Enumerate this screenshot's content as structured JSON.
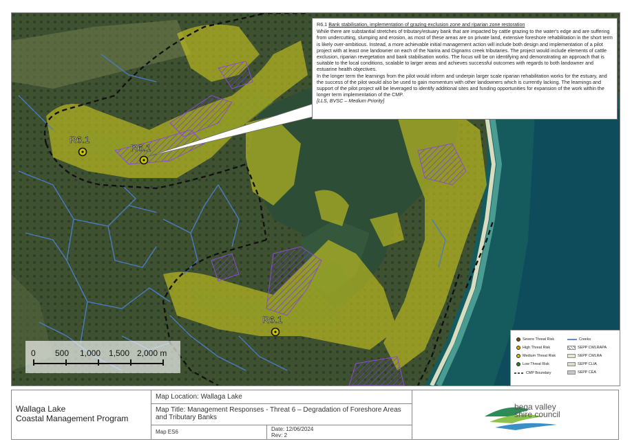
{
  "callout": {
    "ref": "R6.1",
    "heading": "Bank stabilisation, implementation of grazing exclusion zone and riparian zone restoration",
    "para1": "While there are substantial stretches of tributary/estuary bank that are impacted by cattle grazing to the water's edge and are suffering from undercutting, slumping and erosion, as most of these areas are on private land, extensive foreshore rehabilitation in the short term is likely over-ambitious. Instead, a more achievable initial management action will include both design and implementation of a pilot project with at least one landowner on each of the Narira and Dignams creek tributaries. The project would include elements of cattle exclusion, riparian revegetation and bank stabilisation works. The focus will be on identifying and demonstrating an approach that is suitable to the local conditions, scalable to larger areas and achieves successful outcomes with regards to both landowner and estuarine health objectives.",
    "para2": "In the longer term the learnings from the pilot would inform and underpin larger scale riparian rehabilitation works for the estuary, and the success of the pilot would also be used to gain momentum with other landowners which is currently lacking. The learnings and support of the pilot project will be leveraged to identify additional sites and funding opportunities for expansion of the work within the longer term implementation of the CMP.",
    "priority": "[LLS, BVSC – Medium Priority]"
  },
  "markers": [
    {
      "label": "R6.1"
    },
    {
      "label": "R6.1"
    },
    {
      "label": "R6.1"
    }
  ],
  "scalebar": {
    "labels": [
      "0",
      "500",
      "1,000",
      "1,500",
      "2,000 m"
    ]
  },
  "legend": {
    "severe": "Severe Threat Risk",
    "high": "High Threat Risk",
    "medium": "Medium Threat Risk",
    "low": "Low Threat Risk",
    "boundary": "CMP Boundary",
    "creeks": "Creeks",
    "cwlrapa": "SEPP CWLRAPA",
    "cwlra": "SEPP CWLRA",
    "cla": "SEPP CLIA",
    "cea": "SEPP CEA",
    "colors": {
      "severe": "#7a4a10",
      "high": "#d9a400",
      "medium": "#c8c400",
      "low": "#2e7d32",
      "creek": "#3f6fb0"
    }
  },
  "titleblock": {
    "project_line1": "Wallaga Lake",
    "project_line2": "Coastal Management Program",
    "location": "Map Location: Wallaga Lake",
    "title": "Map Title: Management Responses - Threat 6 – Degradation of Foreshore Areas and Tributary Banks",
    "map_no": "Map ES6",
    "date": "Date: 12/06/2024",
    "rev": "Rev: 2",
    "logo_line1": "bega valley",
    "logo_line2": "shire council"
  }
}
